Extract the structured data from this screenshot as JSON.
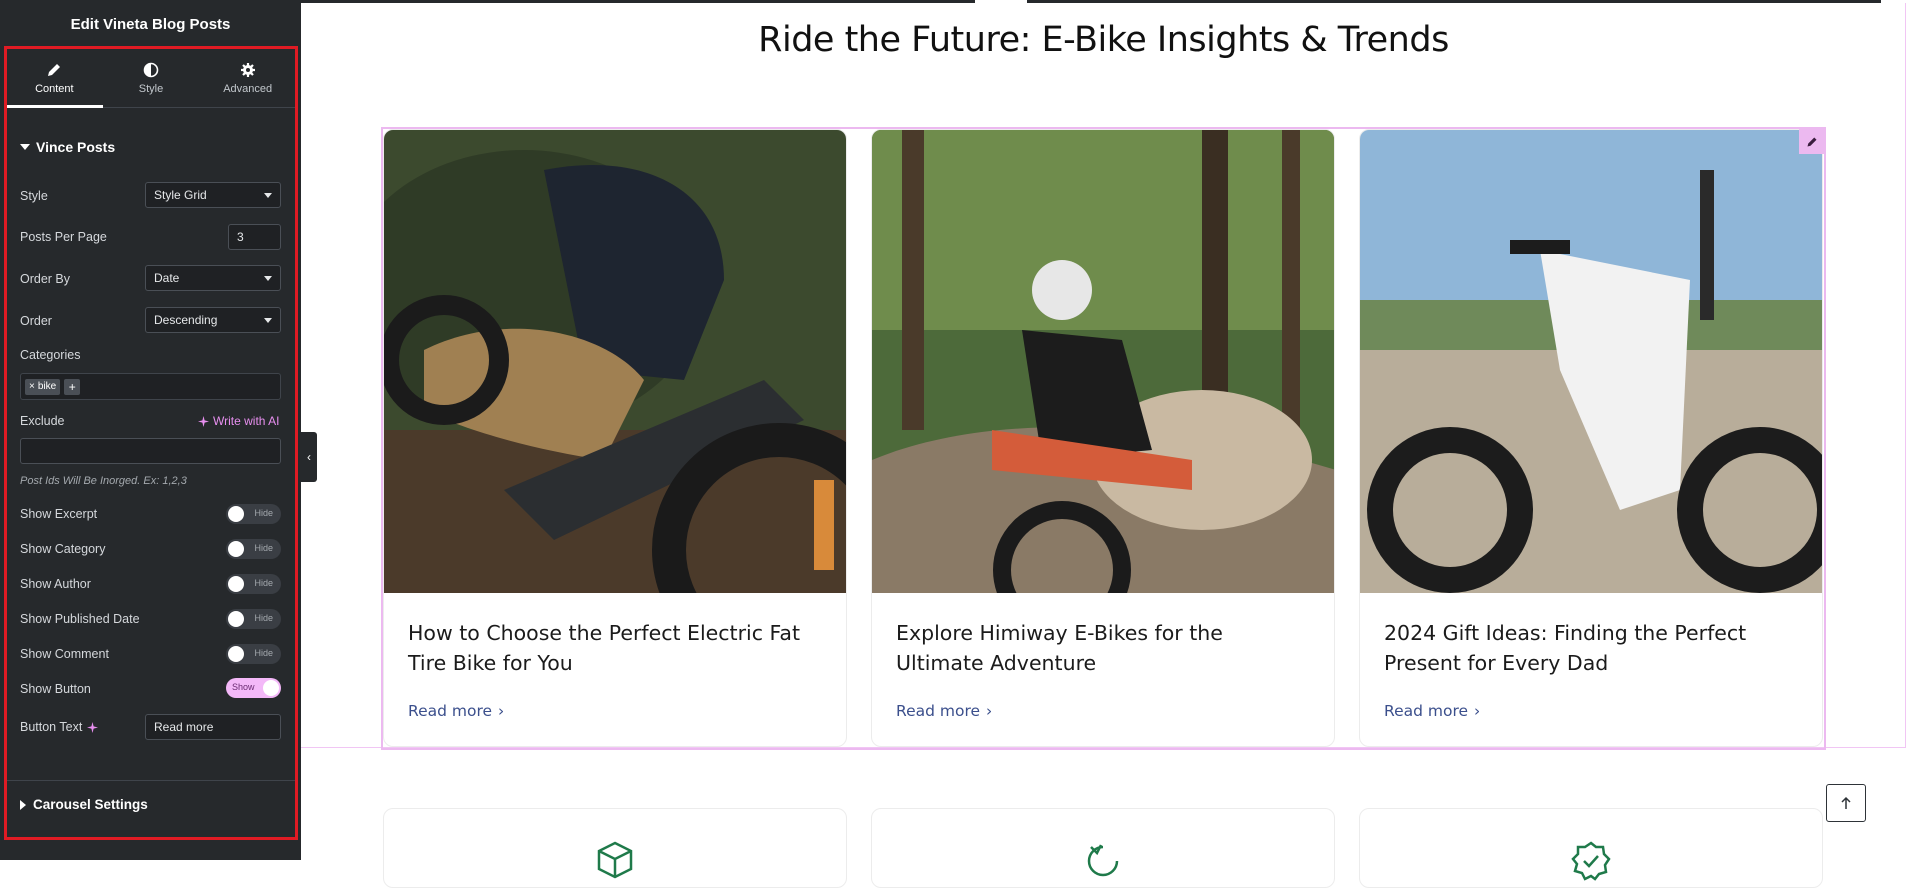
{
  "panel": {
    "title": "Edit Vineta Blog Posts",
    "tabs": [
      {
        "label": "Content",
        "icon": "pencil-icon"
      },
      {
        "label": "Style",
        "icon": "half-circle-icon"
      },
      {
        "label": "Advanced",
        "icon": "gear-icon"
      }
    ],
    "section_title": "Vince Posts",
    "style": {
      "label": "Style",
      "value": "Style Grid"
    },
    "posts_per_page": {
      "label": "Posts Per Page",
      "value": "3"
    },
    "order_by": {
      "label": "Order By",
      "value": "Date"
    },
    "order": {
      "label": "Order",
      "value": "Descending"
    },
    "categories": {
      "label": "Categories",
      "tags": [
        "bike"
      ],
      "add": "+"
    },
    "exclude": {
      "label": "Exclude",
      "ai_link": "Write with AI",
      "value": "",
      "hint": "Post Ids Will Be Inorged. Ex: 1,2,3"
    },
    "toggles": [
      {
        "label": "Show Excerpt",
        "state": "Hide"
      },
      {
        "label": "Show Category",
        "state": "Hide"
      },
      {
        "label": "Show Author",
        "state": "Hide"
      },
      {
        "label": "Show Published Date",
        "state": "Hide"
      },
      {
        "label": "Show Comment",
        "state": "Hide"
      },
      {
        "label": "Show Button",
        "state": "Show"
      }
    ],
    "button_text": {
      "label": "Button Text",
      "value": "Read more"
    },
    "carousel_section": "Carousel Settings",
    "accent_color": "#e01b24"
  },
  "preview": {
    "heading": "Ride the Future: E-Bike Insights & Trends",
    "posts": [
      {
        "title": "How to Choose the Perfect Electric Fat Tire Bike for You",
        "button": "Read more"
      },
      {
        "title": "Explore Himiway E-Bikes for the Ultimate Adventure",
        "button": "Read more"
      },
      {
        "title": "2024 Gift Ideas: Finding the Perfect Present for Every Dad",
        "button": "Read more"
      }
    ],
    "features": [
      "box-icon",
      "refresh-icon",
      "badge-check-icon"
    ],
    "widget_outline_color": "#ecb9f0",
    "link_color": "#3b4f8c",
    "feature_icon_color": "#1f7a4a"
  }
}
